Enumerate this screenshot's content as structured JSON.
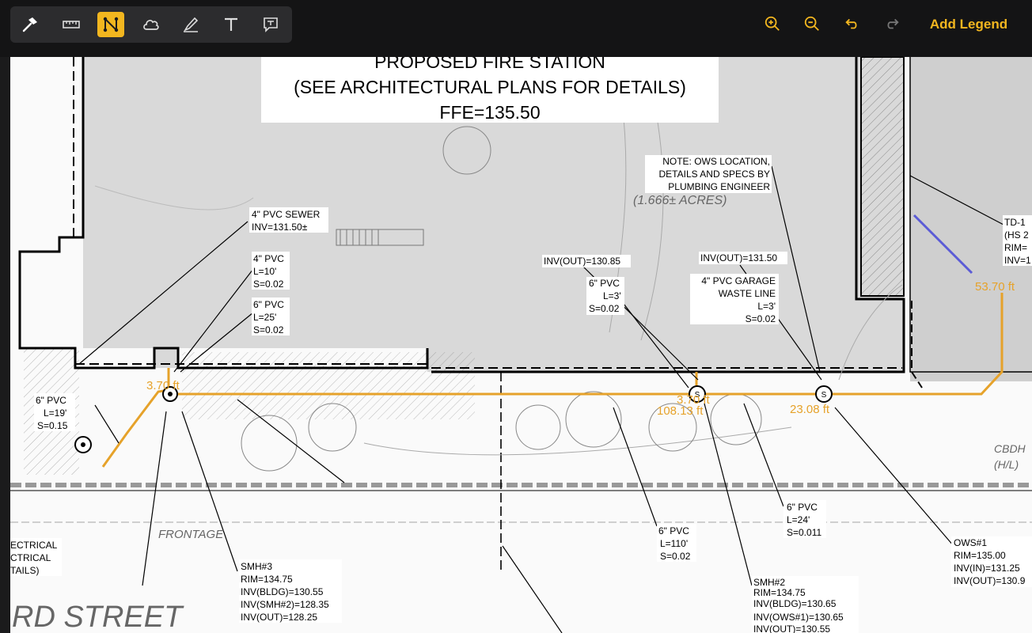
{
  "toolbar": {
    "tools": [
      {
        "name": "hammer-icon",
        "label": "Hammer"
      },
      {
        "name": "ruler-icon",
        "label": "Measure"
      },
      {
        "name": "polyline-icon",
        "label": "Polyline",
        "active": true
      },
      {
        "name": "cloud-icon",
        "label": "Cloud"
      },
      {
        "name": "highlighter-icon",
        "label": "Highlight"
      },
      {
        "name": "text-icon",
        "label": "Text"
      },
      {
        "name": "callout-icon",
        "label": "Callout"
      }
    ],
    "right_tools": [
      "zoom-in-icon",
      "zoom-out-icon",
      "undo-icon",
      "redo-icon"
    ],
    "add_legend_label": "Add Legend",
    "accent_color": "#f2b61f"
  },
  "drawing": {
    "title": {
      "line1": "PROPOSED FIRE STATION",
      "line2": "(SEE ARCHITECTURAL PLANS FOR DETAILS)",
      "line3": "FFE=135.50"
    },
    "notes": {
      "ows_note": [
        "NOTE: OWS LOCATION,",
        "DETAILS AND SPECS BY",
        "PLUMBING ENGINEER"
      ],
      "sewer_4in": [
        "4\" PVC SEWER",
        "INV=131.50±"
      ],
      "pvc_4_10": [
        "4\" PVC",
        "L=10'",
        "S=0.02"
      ],
      "pvc_6_25": [
        "6\" PVC",
        "L=25'",
        "S=0.02"
      ],
      "inv_out_1": "INV(OUT)=130.85",
      "pvc_6_3": [
        "6\" PVC",
        "L=3'",
        "S=0.02"
      ],
      "inv_out_2": "INV(OUT)=131.50",
      "garage": [
        "4\" PVC GARAGE",
        "WASTE LINE",
        "L=3'",
        "S=0.02"
      ],
      "pvc_6_19": [
        "6\" PVC",
        "L=19'",
        "S=0.15"
      ],
      "pvc_6_110": [
        "6\" PVC",
        "L=110'",
        "S=0.02"
      ],
      "pvc_6_24": [
        "6\" PVC",
        "L=24'",
        "S=0.011"
      ],
      "smh3": [
        "SMH#3",
        "RIM=134.75",
        "INV(BLDG)=130.55",
        "INV(SMH#2)=128.35",
        "INV(OUT)=128.25"
      ],
      "smh2": [
        "SMH#2",
        "RIM=134.75",
        "INV(BLDG)=130.65",
        "INV(OWS#1)=130.65",
        "INV(OUT)=130.55"
      ],
      "ows1": [
        "OWS#1",
        "RIM=135.00",
        "INV(IN)=131.25",
        "INV(OUT)=130.9"
      ],
      "td1": [
        "TD-1",
        "(HS 2",
        "RIM=",
        "INV=1"
      ],
      "electrical": [
        "ECTRICAL",
        "CTRICAL",
        "TAILS)"
      ],
      "street": "RD STREET",
      "frontage": "FRONTAGE",
      "acres": "(1.666± ACRES)",
      "cbdh": "CBDH",
      "hl": "(H/L)"
    },
    "measurements": [
      {
        "label": "53.70 ft"
      },
      {
        "label": "108.13 ft"
      },
      {
        "label": "23.08 ft"
      },
      {
        "label": "3.70 ft"
      },
      {
        "label": "3.70 ft"
      }
    ],
    "plan_color_line": "#e6a22a",
    "plan_color_selection": "#5b5bd6"
  }
}
